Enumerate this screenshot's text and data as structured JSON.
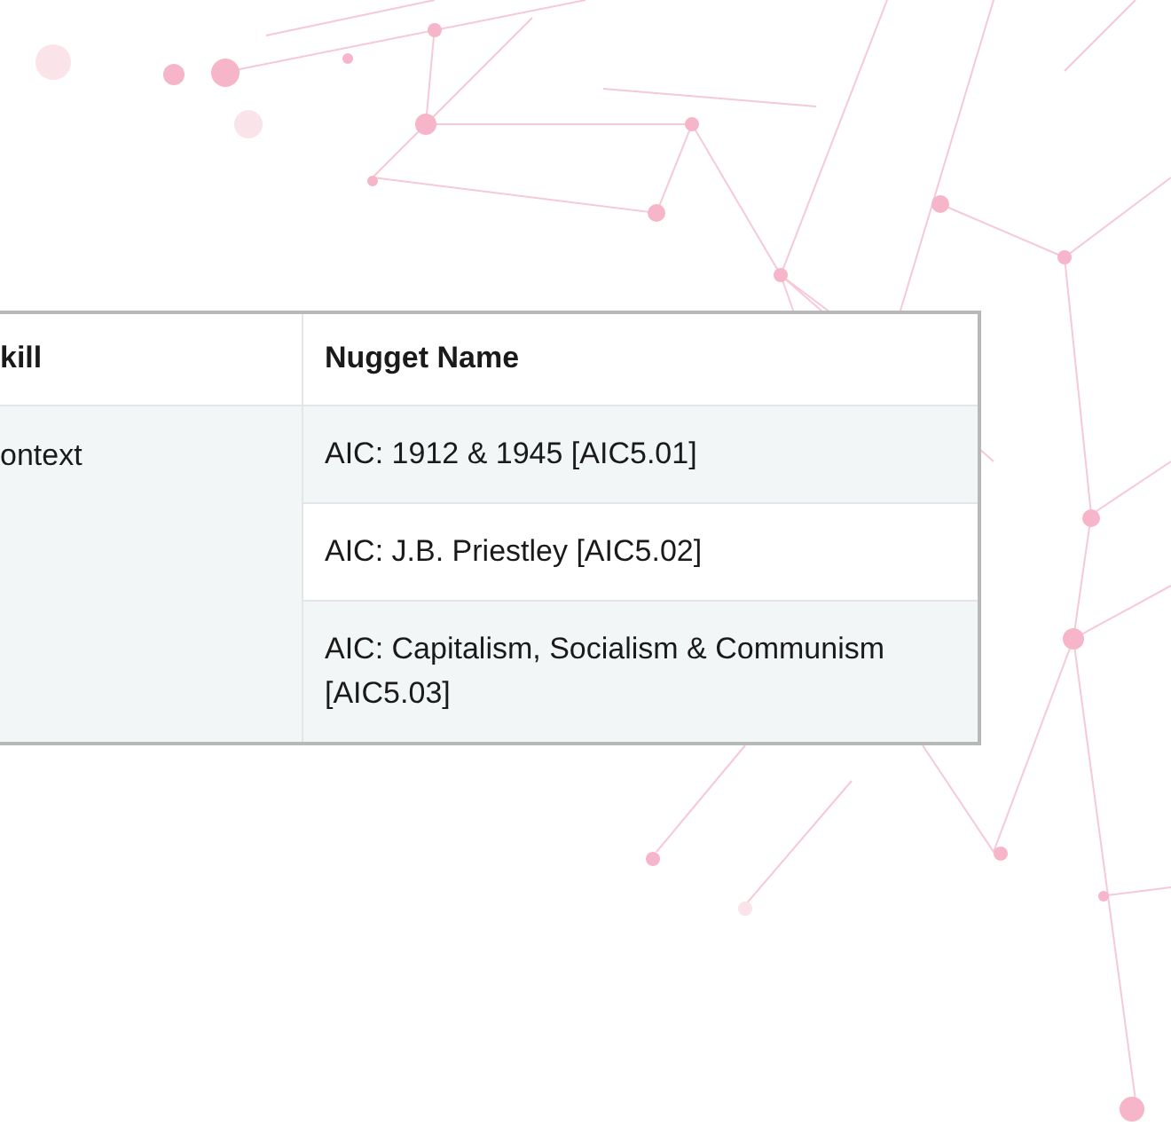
{
  "table": {
    "columns": [
      "kill",
      "Nugget Name"
    ],
    "rows": [
      {
        "column_1": "ontext",
        "nuggets": [
          "AIC: 1912 & 1945 [AIC5.01]",
          "AIC: J.B. Priestley [AIC5.02]",
          "AIC: Capitalism, Socialism & Communism [AIC5.03]"
        ]
      }
    ]
  }
}
